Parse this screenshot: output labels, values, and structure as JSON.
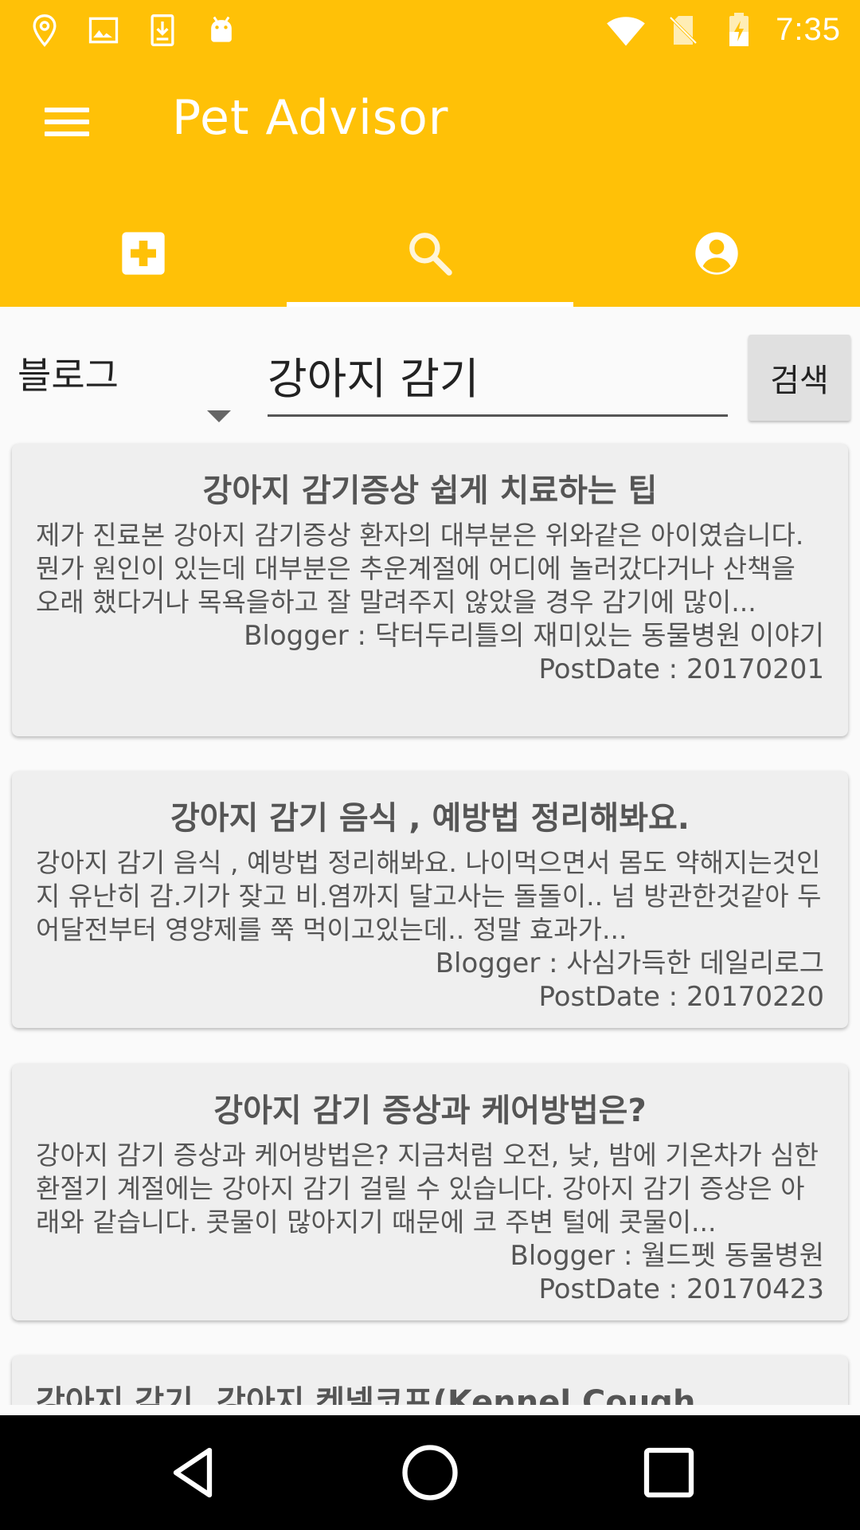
{
  "status_bar": {
    "time": "7:35",
    "left_icons": [
      "location-pin-icon",
      "image-icon",
      "download-icon",
      "android-icon"
    ],
    "right_icons": [
      "wifi-icon",
      "no-sim-icon",
      "battery-charging-icon"
    ]
  },
  "app": {
    "title": "Pet Advisor",
    "colors": {
      "primary": "#ffc107",
      "on_primary": "#ffffff"
    }
  },
  "tabs": [
    {
      "icon": "medical-plus-icon",
      "selected": false
    },
    {
      "icon": "search-icon",
      "selected": true
    },
    {
      "icon": "account-icon",
      "selected": false
    }
  ],
  "search": {
    "category": "블로그",
    "query": "강아지 감기",
    "button_label": "검색"
  },
  "results": [
    {
      "title": "강아지 감기증상 쉽게 치료하는 팁",
      "description": "제가 진료본 강아지 감기증상 환자의 대부분은 위와같은 아이였습니다. 뭔가 원인이 있는데 대부분은 추운계절에 어디에 놀러갔다거나 산책을 오래 했다거나 목욕을하고 잘 말려주지 않았을 경우 감기에 많이...",
      "blogger": "Blogger : 닥터두리틀의 재미있는 동물병원 이야기",
      "post_date": "PostDate : 20170201"
    },
    {
      "title": "강아지 감기 음식 , 예방법 정리해봐요.",
      "description": "강아지 감기 음식 , 예방법 정리해봐요. 나이먹으면서 몸도 약해지는것인지 유난히 감.기가 잦고 비.염까지 달고사는 돌돌이.. 넘 방관한것같아 두어달전부터 영양제를 쭉 먹이고있는데.. 정말 효과가...",
      "blogger": "Blogger : 사심가득한 데일리로그",
      "post_date": "PostDate : 20170220"
    },
    {
      "title": "강아지 감기 증상과 케어방법은?",
      "description": "강아지 감기 증상과 케어방법은? 지금처럼 오전, 낮, 밤에 기온차가 심한 환절기 계절에는 강아지 감기 걸릴 수 있습니다. 강아지 감기 증상은 아래와 같습니다. 콧물이 많아지기 때문에 코 주변 털에 콧물이...",
      "blogger": "Blogger : 월드펫 동물병원",
      "post_date": "PostDate : 20170423"
    },
    {
      "title": "강아지 감기, 강아지 켄넬코프(Kennel Cough",
      "description": "",
      "blogger": "",
      "post_date": ""
    }
  ],
  "nav_bar": {
    "buttons": [
      "back-icon",
      "home-icon",
      "recents-icon"
    ]
  }
}
